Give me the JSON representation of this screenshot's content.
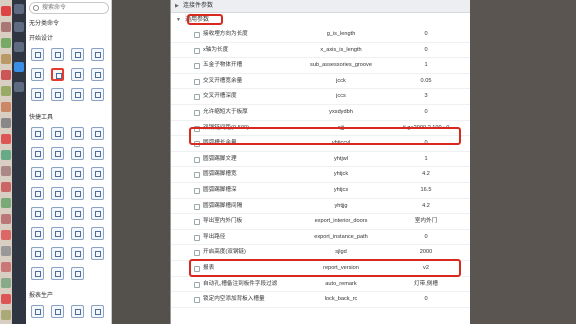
{
  "panel": {
    "search_placeholder": "搜索命令",
    "categories": [
      {
        "label": "无分类命令"
      },
      {
        "label": "开始设计"
      },
      {
        "label": "快捷工具"
      },
      {
        "label": "报表生产"
      }
    ]
  },
  "main": {
    "header": "连接件参数",
    "section": "通用参数",
    "rows": [
      {
        "label": "接收埋方向为长度",
        "key": "g_is_length",
        "value": "0"
      },
      {
        "label": "x轴为长度",
        "key": "x_axis_is_length",
        "value": "0"
      },
      {
        "label": "五金子物体开槽",
        "key": "sub_assessories_groove",
        "value": "1"
      },
      {
        "label": "交叉开槽宽余量",
        "key": "jcck",
        "value": "0.05"
      },
      {
        "label": "交叉开槽深度",
        "key": "jccs",
        "value": "3"
      },
      {
        "label": "允许缩短大于板厚",
        "key": "yxsdydbh",
        "value": "0"
      },
      {
        "label": "双钢链间距(0-500)",
        "key": "sjjj",
        "value": "# g>2000 ? 100 : 0"
      },
      {
        "label": "圆弧槽长余量",
        "key": "yhtjccyl",
        "value": "0"
      },
      {
        "label": "圆弧踢脚文理",
        "key": "yhtjwl",
        "value": "1"
      },
      {
        "label": "圆弧踢脚槽宽",
        "key": "yhtjck",
        "value": "4.2"
      },
      {
        "label": "圆弧踢脚槽深",
        "key": "yhtjcs",
        "value": "16.5"
      },
      {
        "label": "圆弧踢脚槽间隔",
        "key": "yhtjjg",
        "value": "4.2"
      },
      {
        "label": "导出室内外门板",
        "key": "export_interior_doors",
        "value": "室内外门"
      },
      {
        "label": "导出路径",
        "key": "export_instance_path",
        "value": "0"
      },
      {
        "label": "开启高度(双钢链)",
        "key": "sjlgd",
        "value": "2000"
      },
      {
        "label": "报表",
        "key": "report_version",
        "value": "v2"
      },
      {
        "label": "自动孔,槽备注到板件字段过滤",
        "key": "auto_remark",
        "value": "灯带,侧槽"
      },
      {
        "label": "锁定内空添加背板入槽量",
        "key": "lock_back_rc",
        "value": "0"
      }
    ]
  },
  "colors": {
    "highlight": "#d9281e",
    "accent": "#3b8ee6"
  }
}
